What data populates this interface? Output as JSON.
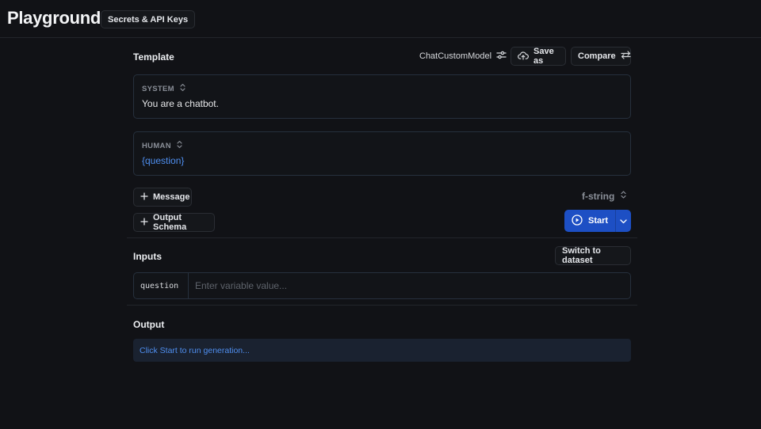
{
  "header": {
    "title": "Playground",
    "secrets_label": "Secrets & API Keys"
  },
  "template": {
    "title": "Template",
    "model_name": "ChatCustomModel",
    "save_as_label": "Save as",
    "compare_label": "Compare",
    "messages": [
      {
        "role": "SYSTEM",
        "content": "You are a chatbot."
      },
      {
        "role": "HUMAN",
        "content": "{question}"
      }
    ],
    "add_message_label": "Message",
    "add_output_schema_label": "Output Schema",
    "format": "f-string",
    "start_label": "Start"
  },
  "inputs": {
    "title": "Inputs",
    "switch_label": "Switch to dataset",
    "variable_name": "question",
    "variable_placeholder": "Enter variable value..."
  },
  "output": {
    "title": "Output",
    "hint": "Click Start to run generation..."
  },
  "colors": {
    "background": "#111216",
    "accent": "#1d4fc4",
    "variable_text": "#4f8ff0"
  }
}
